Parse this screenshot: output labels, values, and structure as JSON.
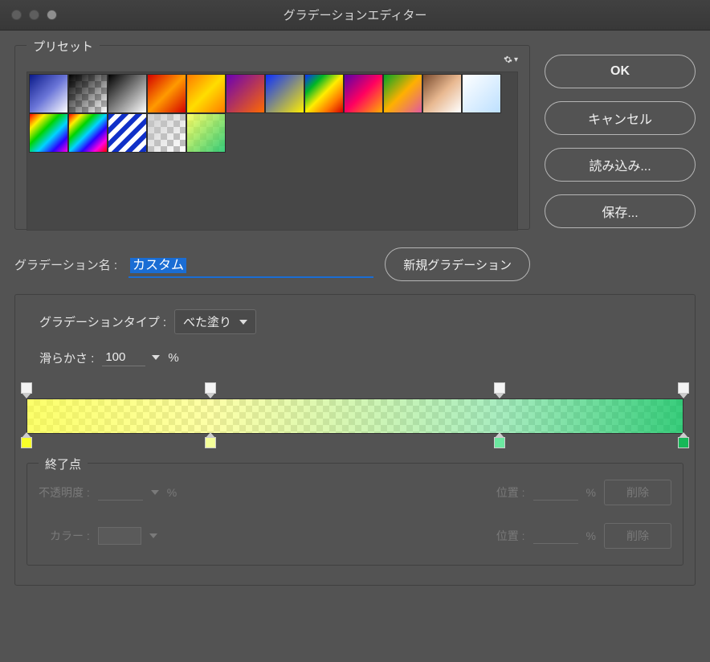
{
  "window": {
    "title": "グラデーションエディター"
  },
  "buttons": {
    "ok": "OK",
    "cancel": "キャンセル",
    "load": "読み込み...",
    "save": "保存...",
    "new_gradient": "新規グラデーション",
    "delete": "削除"
  },
  "presets": {
    "legend": "プリセット",
    "items": [
      {
        "id": "p1",
        "css": "linear-gradient(135deg,#0b1b8a,#6a75d8,#fff)"
      },
      {
        "id": "p2",
        "css": "linear-gradient(135deg,#000,rgba(0,0,0,0))",
        "checker": true
      },
      {
        "id": "p3",
        "css": "linear-gradient(135deg,#000,#fff)"
      },
      {
        "id": "p4",
        "css": "linear-gradient(135deg,#d40000,#ff9a00,#d40000)"
      },
      {
        "id": "p5",
        "css": "linear-gradient(135deg,#ff7a00,#ffdd00,#ff7a00)"
      },
      {
        "id": "p6",
        "css": "linear-gradient(135deg,#6a00b5,#ff6a00)"
      },
      {
        "id": "p7",
        "css": "linear-gradient(135deg,#0b2fff,#ffee00)"
      },
      {
        "id": "p8",
        "css": "linear-gradient(135deg,#0b2fff,#00b526,#ffee00,#ff7a00,#d40000)"
      },
      {
        "id": "p9",
        "css": "linear-gradient(135deg,#5a00a8,#ff0060,#ffb000)"
      },
      {
        "id": "p10",
        "css": "linear-gradient(135deg,#00a526,#ffb000,#e05aa0)"
      },
      {
        "id": "p11",
        "css": "linear-gradient(135deg,#7a4b2f,#e8b890,#fff)"
      },
      {
        "id": "p12",
        "css": "linear-gradient(135deg,#ffffff,#bde0ff)"
      },
      {
        "id": "p13",
        "css": "linear-gradient(135deg,#ff0000,#ffee00,#00d400,#00d4ff,#2b00ff,#ff00e0)"
      },
      {
        "id": "p14",
        "css": "linear-gradient(135deg,#ff0000,#ffee00,#00d400,#00d4ff,#2b00ff,#ff00e0,#ff0000)"
      },
      {
        "id": "p15",
        "css": "repeating-linear-gradient(135deg,#1030c8 0 6px,#fff 6px 12px)"
      },
      {
        "id": "p16",
        "css": "linear-gradient(135deg,rgba(200,200,200,0.9),rgba(200,200,200,0))",
        "checker": true
      },
      {
        "id": "p17",
        "css": "linear-gradient(135deg,rgba(252,255,80,0.85),rgba(36,200,110,0.9))",
        "checker": true
      }
    ]
  },
  "name": {
    "label": "グラデーション名 :",
    "value": "カスタム"
  },
  "type_group": {
    "legend": "",
    "type_label": "グラデーションタイプ :",
    "type_value": "べた塗り",
    "smooth_label": "滑らかさ :",
    "smooth_value": "100",
    "percent": "%"
  },
  "gradient": {
    "opacity_stops": [
      {
        "pos": 0
      },
      {
        "pos": 28
      },
      {
        "pos": 72
      },
      {
        "pos": 100
      }
    ],
    "color_stops": [
      {
        "pos": 0,
        "color": "#f8ff2a"
      },
      {
        "pos": 28,
        "color": "#f4ff9a"
      },
      {
        "pos": 72,
        "color": "#6ce8a0"
      },
      {
        "pos": 100,
        "color": "#17b858"
      }
    ]
  },
  "endpoints": {
    "legend": "終了点",
    "opacity_label": "不透明度 :",
    "color_label": "カラー :",
    "position_label": "位置 :",
    "percent": "%"
  }
}
